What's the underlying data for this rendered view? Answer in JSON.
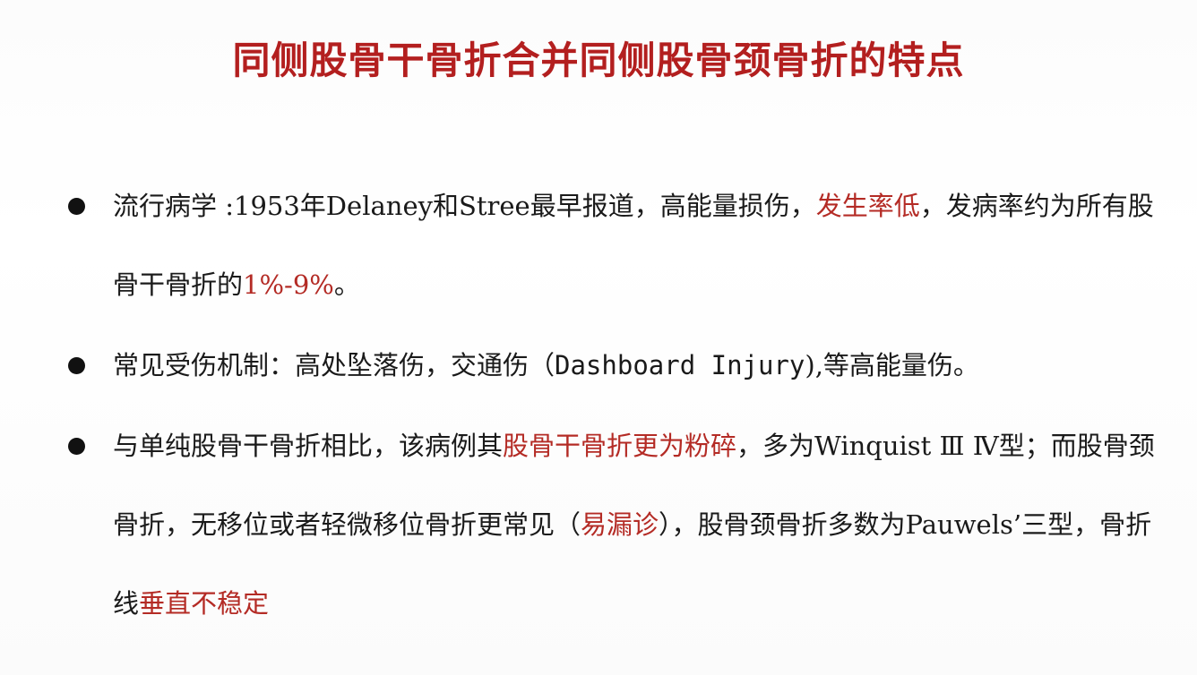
{
  "title": "同侧股骨干骨折合并同侧股骨颈骨折的特点",
  "bullets": [
    {
      "part1": "流行病学 :1953年Delaney和Stree最早报道，高能量损伤，",
      "red1": "发生率低",
      "part2": "，发病率约为所有股骨干骨折的",
      "red2": "1%-9%",
      "part3": "。"
    },
    {
      "part1": "常见受伤机制：高处坠落伤，交通伤（",
      "mono": "Dashboard Injury",
      "part2": "),等高能量伤。"
    },
    {
      "part1": "与单纯股骨干骨折相比，该病例其",
      "red1": "股骨干骨折更为粉碎",
      "part2": "，多为Winquist Ⅲ Ⅳ型；而股骨颈骨折，无移位或者轻微移位骨折更常见（",
      "red2": "易漏诊",
      "part3": "），股骨颈骨折多数为Pauwels’三型，骨折线",
      "red3": "垂直不稳定"
    }
  ],
  "colors": {
    "title": "#b31f1f",
    "highlight": "#b42b25",
    "text": "#1a1a1a"
  }
}
